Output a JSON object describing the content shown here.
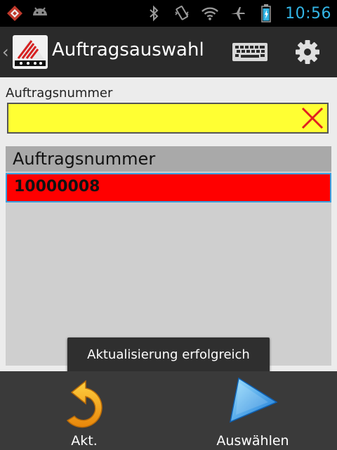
{
  "statusbar": {
    "time": "10:56",
    "icons": [
      "app-notification-icon",
      "android-icon",
      "bluetooth-icon",
      "vibrate-icon",
      "wifi-icon",
      "airplane-icon",
      "battery-icon"
    ]
  },
  "actionbar": {
    "title": "Auftragsauswahl",
    "up_icon": "chevron-left-icon",
    "keyboard_icon": "keyboard-icon",
    "settings_icon": "gear-icon"
  },
  "search": {
    "label": "Auftragsnummer",
    "value": "",
    "clear_icon": "close-icon",
    "bg_color": "#ffff33"
  },
  "list": {
    "header": "Auftragsnummer",
    "rows": [
      {
        "value": "10000008",
        "selected": true
      }
    ],
    "selected_color": "#ff0000"
  },
  "toast": {
    "message": "Aktualisierung erfolgreich"
  },
  "bottombar": {
    "refresh_label": "Akt.",
    "refresh_icon": "refresh-arrow-icon",
    "select_label": "Auswählen",
    "select_icon": "play-triangle-icon"
  }
}
